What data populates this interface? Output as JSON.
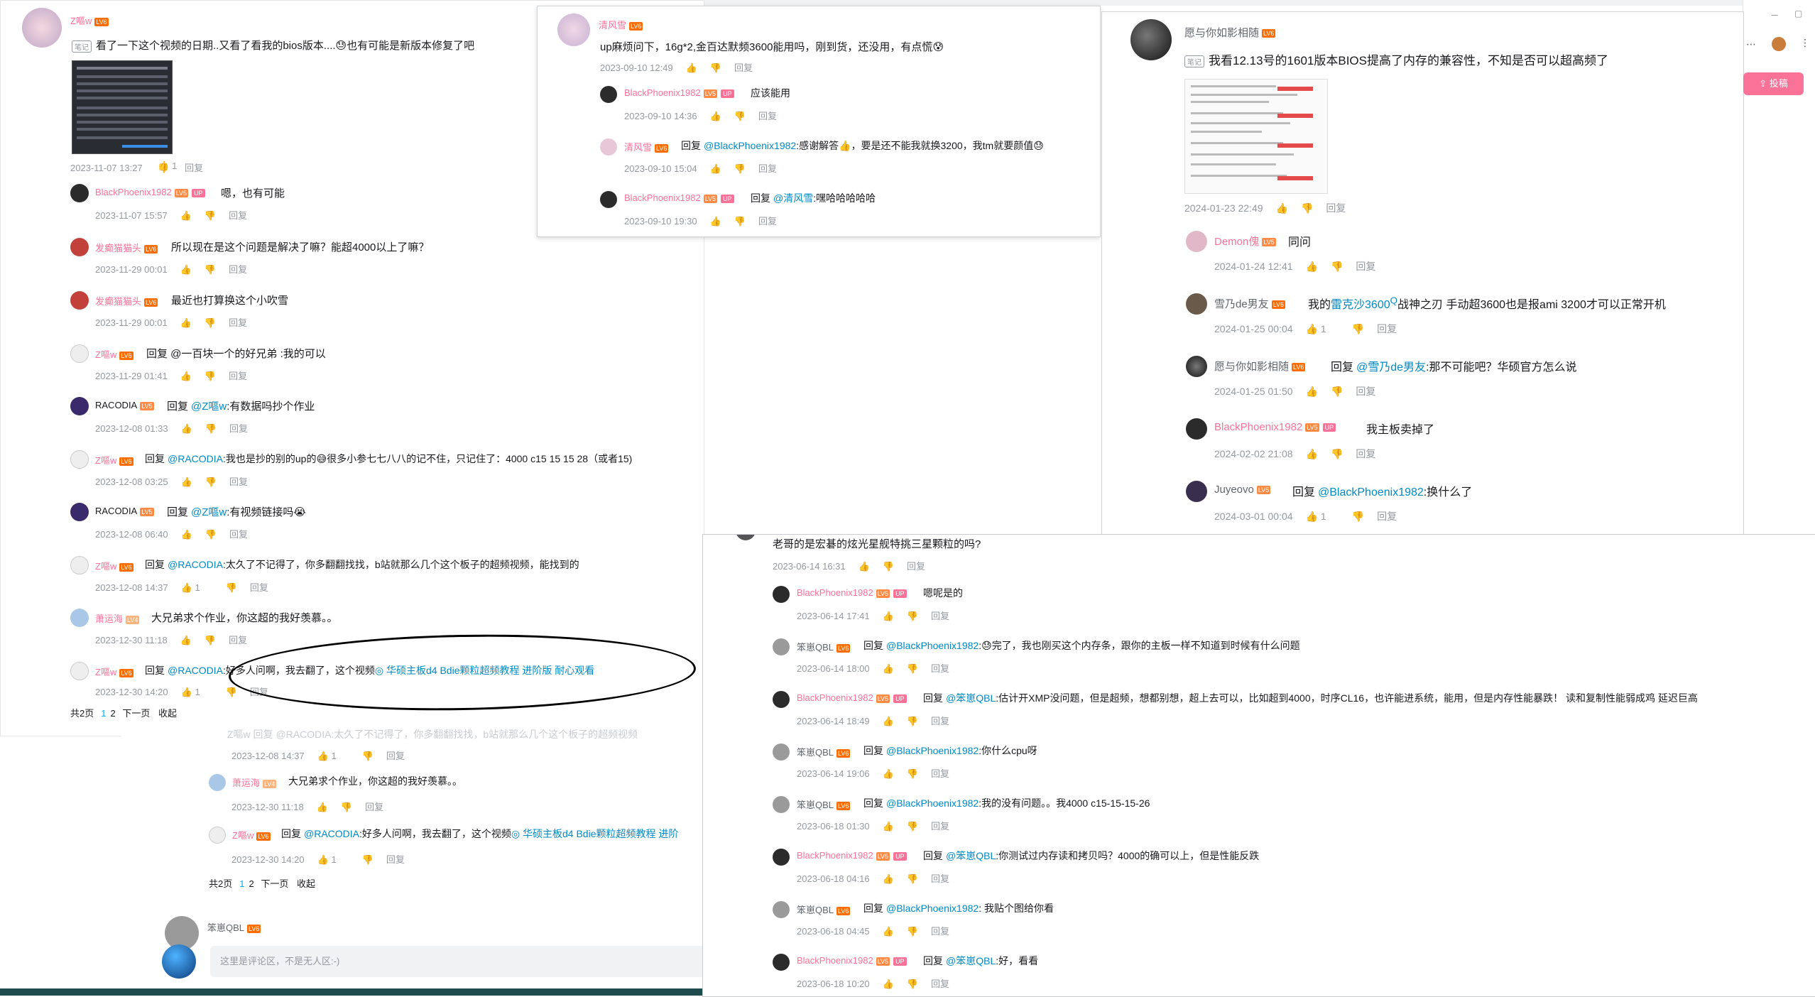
{
  "left": {
    "comments": [
      {
        "user": "Z嘔w",
        "level": "LV6",
        "text": "看了一下这个视频的日期..又看了看我的bios版本....",
        "text2": "也有可能是新版本修复了吧",
        "tag": "笔记",
        "date": "2023-11-07 13:27",
        "likes": "1",
        "reply": "回复"
      },
      {
        "user": "BlackPhoenix1982",
        "level": "LV5",
        "up": "UP",
        "text": "嗯，也有可能",
        "date": "2023-11-07 15:57",
        "reply": "回复"
      },
      {
        "user": "发癫猫猫头",
        "level": "LV6",
        "text": "所以现在是这个问题是解决了嘛？能超4000以上了嘛？",
        "date": "2023-11-29 00:01",
        "reply": "回复"
      },
      {
        "user": "发癫猫猫头",
        "level": "LV6",
        "text": "最近也打算换这个小吹雪",
        "date": "2023-11-29 00:01",
        "reply": "回复"
      },
      {
        "user": "Z嘔w",
        "level": "LV6",
        "text": "回复 @一百块一个的好兄弟 :我的可以",
        "date": "2023-11-29 01:41",
        "reply": "回复"
      },
      {
        "user": "RACODIA",
        "level": "LV5",
        "text_pre": "回复",
        "at": "@Z嘔w",
        "text": ":有数据吗抄个作业",
        "date": "2023-12-08 01:33",
        "reply": "回复"
      },
      {
        "user": "Z嘔w",
        "level": "LV6",
        "text_pre": "回复",
        "at": "@RACODIA",
        "text": ":我也是抄的别的up的",
        "text2": "很多小参七七八八的记不住，只记住了：4000 c15 15 15 28（或者15)",
        "date": "2023-12-08 03:25",
        "reply": "回复"
      },
      {
        "user": "RACODIA",
        "level": "LV5",
        "text_pre": "回复",
        "at": "@Z嘔w",
        "text": ":有视频链接吗",
        "date": "2023-12-08 06:40",
        "reply": "回复"
      },
      {
        "user": "Z嘔w",
        "level": "LV6",
        "text_pre": "回复",
        "at": "@RACODIA",
        "text": ":太久了不记得了，你多翻翻找找，b站就那么几个这个板子的超频视频，能找到的",
        "date": "2023-12-08 14:37",
        "likes": "1",
        "reply": "回复"
      },
      {
        "user": "萧运海",
        "level": "LV4",
        "text": "大兄弟求个作业，你这超的我好羡慕。。",
        "date": "2023-12-30 11:18",
        "reply": "回复"
      },
      {
        "user": "Z嘔w",
        "level": "LV6",
        "text_pre": "回复",
        "at": "@RACODIA",
        "text": ":好多人问啊，我去翻了，这个视频",
        "link": "华硕主板d4 Bdie颗粒超频教程 进阶版 耐心观看",
        "date": "2023-12-30 14:20",
        "likes": "1",
        "reply": "回复"
      }
    ],
    "pager": {
      "total": "共2页",
      "p1": "1",
      "p2": "2",
      "next": "下一页",
      "collapse": "收起"
    }
  },
  "under": {
    "rows": [
      {
        "date": "2023-12-08 14:37",
        "likes": "1",
        "reply": "回复"
      },
      {
        "user": "萧运海",
        "level": "LV4",
        "text": "大兄弟求个作业，你这超的我好羡慕。。",
        "date": "2023-12-30 11:18",
        "reply": "回复"
      },
      {
        "user": "Z嘔w",
        "level": "LV6",
        "text_pre": "回复",
        "at": "@RACODIA",
        "text": ":好多人问啊，我去翻了，这个视频",
        "link": "华硕主板d4 Bdie颗粒超频教程 进阶",
        "date": "2023-12-30 14:20",
        "likes": "1",
        "reply": "回复"
      }
    ],
    "pager": {
      "total": "共2页",
      "p1": "1",
      "p2": "2",
      "next": "下一页",
      "collapse": "收起"
    },
    "next_user": "笨崽QBL",
    "next_level": "LV6",
    "input_placeholder": "这里是评论区，不是无人区:-)"
  },
  "top": {
    "comments": [
      {
        "user": "清风雪",
        "level": "LV6",
        "text": "up麻烦问下，16g*2,金百达默频3600能用吗，刚到货，还没用，有点慌",
        "date": "2023-09-10 12:49",
        "reply": "回复"
      },
      {
        "user": "BlackPhoenix1982",
        "level": "LV5",
        "up": "UP",
        "text": "应该能用",
        "date": "2023-09-10 14:36",
        "reply": "回复"
      },
      {
        "user": "清风雪",
        "level": "LV6",
        "text_pre": "回复",
        "at": "@BlackPhoenix1982",
        "text": ":感谢解答",
        "text2": "，要是还不能我就换3200，我tm就要颜值",
        "date": "2023-09-10 15:04",
        "reply": "回复"
      },
      {
        "user": "BlackPhoenix1982",
        "level": "LV5",
        "up": "UP",
        "text_pre": "回复",
        "at": "@清风雪",
        "text": ":嘿哈哈哈哈哈",
        "date": "2023-09-10 19:30",
        "reply": "回复"
      }
    ]
  },
  "right": {
    "comments": [
      {
        "user": "愿与你如影相随",
        "level": "LV6",
        "tag": "笔记",
        "text": "我看12.13号的1601版本BIOS提高了内存的兼容性，不知是否可以超高频了",
        "date": "2024-01-23 22:49",
        "reply": "回复"
      },
      {
        "user": "Demon傀",
        "level": "LV5",
        "text": "同问",
        "date": "2024-01-24 12:41",
        "reply": "回复"
      },
      {
        "user": "雪乃de男友",
        "level": "LV6",
        "text_pre": "我的",
        "at": "雷克沙3600",
        "text": "战神之刃 手动超3600也是报ami 3200才可以正常开机",
        "date": "2024-01-25 00:04",
        "likes": "1",
        "reply": "回复"
      },
      {
        "user": "愿与你如影相随",
        "level": "LV6",
        "text_pre": "回复",
        "at": "@雪乃de男友",
        "text": ":那不可能吧？华硕官方怎么说",
        "date": "2024-01-25 01:50",
        "reply": "回复"
      },
      {
        "user": "BlackPhoenix1982",
        "level": "LV5",
        "up": "UP",
        "text": "我主板卖掉了",
        "date": "2024-02-02 21:08",
        "reply": "回复"
      },
      {
        "user": "Juyeovo",
        "level": "LV5",
        "text_pre": "回复",
        "at": "@BlackPhoenix1982",
        "text": ":换什么了",
        "date": "2024-03-01 00:04",
        "likes": "1",
        "reply": "回复"
      }
    ],
    "publish": "投稿"
  },
  "bottom": {
    "head_text": "老哥的是宏碁的炫光星舰特挑三星颗粒的吗?",
    "head_date": "2023-06-14 16:31",
    "head_reply": "回复",
    "comments": [
      {
        "user": "BlackPhoenix1982",
        "level": "LV5",
        "up": "UP",
        "text": "嗯呢是的",
        "date": "2023-06-14 17:41",
        "reply": "回复"
      },
      {
        "user": "笨崽QBL",
        "level": "LV6",
        "text_pre": "回复",
        "at": "@BlackPhoenix1982",
        "text": ":",
        "text2": "完了，我也刚买这个内存条，跟你的主板一样不知道到时候有什么问题",
        "date": "2023-06-14 18:00",
        "reply": "回复"
      },
      {
        "user": "BlackPhoenix1982",
        "level": "LV5",
        "up": "UP",
        "text_pre": "回复",
        "at": "@笨崽QBL",
        "text": ":估计开XMP没问题，但是超频，想都别想，超上去可以，比如超到4000，时序CL16，也许能进系统，能用，但是内存性能暴跌！ 读和复制性能弱成鸡 延迟巨高",
        "date": "2023-06-14 18:49",
        "reply": "回复"
      },
      {
        "user": "笨崽QBL",
        "level": "LV6",
        "text_pre": "回复",
        "at": "@BlackPhoenix1982",
        "text": ":你什么cpu呀",
        "date": "2023-06-14 19:06",
        "reply": "回复"
      },
      {
        "user": "笨崽QBL",
        "level": "LV6",
        "text_pre": "回复",
        "at": "@BlackPhoenix1982",
        "text": ":我的没有问题。。我4000 c15-15-15-26",
        "date": "2023-06-18 01:30",
        "reply": "回复"
      },
      {
        "user": "BlackPhoenix1982",
        "level": "LV5",
        "up": "UP",
        "text_pre": "回复",
        "at": "@笨崽QBL",
        "text": ":你测试过内存读和拷贝吗？4000的确可以上，但是性能反跌",
        "date": "2023-06-18 04:16",
        "reply": "回复"
      },
      {
        "user": "笨崽QBL",
        "level": "LV6",
        "text_pre": "回复",
        "at": "@BlackPhoenix1982",
        "text": ": 我贴个图给你看",
        "date": "2023-06-18 04:45",
        "reply": "回复"
      },
      {
        "user": "BlackPhoenix1982",
        "level": "LV5",
        "up": "UP",
        "text_pre": "回复",
        "at": "@笨崽QBL",
        "text": ":好，看看",
        "date": "2023-06-18 10:20",
        "reply": "回复"
      }
    ]
  }
}
